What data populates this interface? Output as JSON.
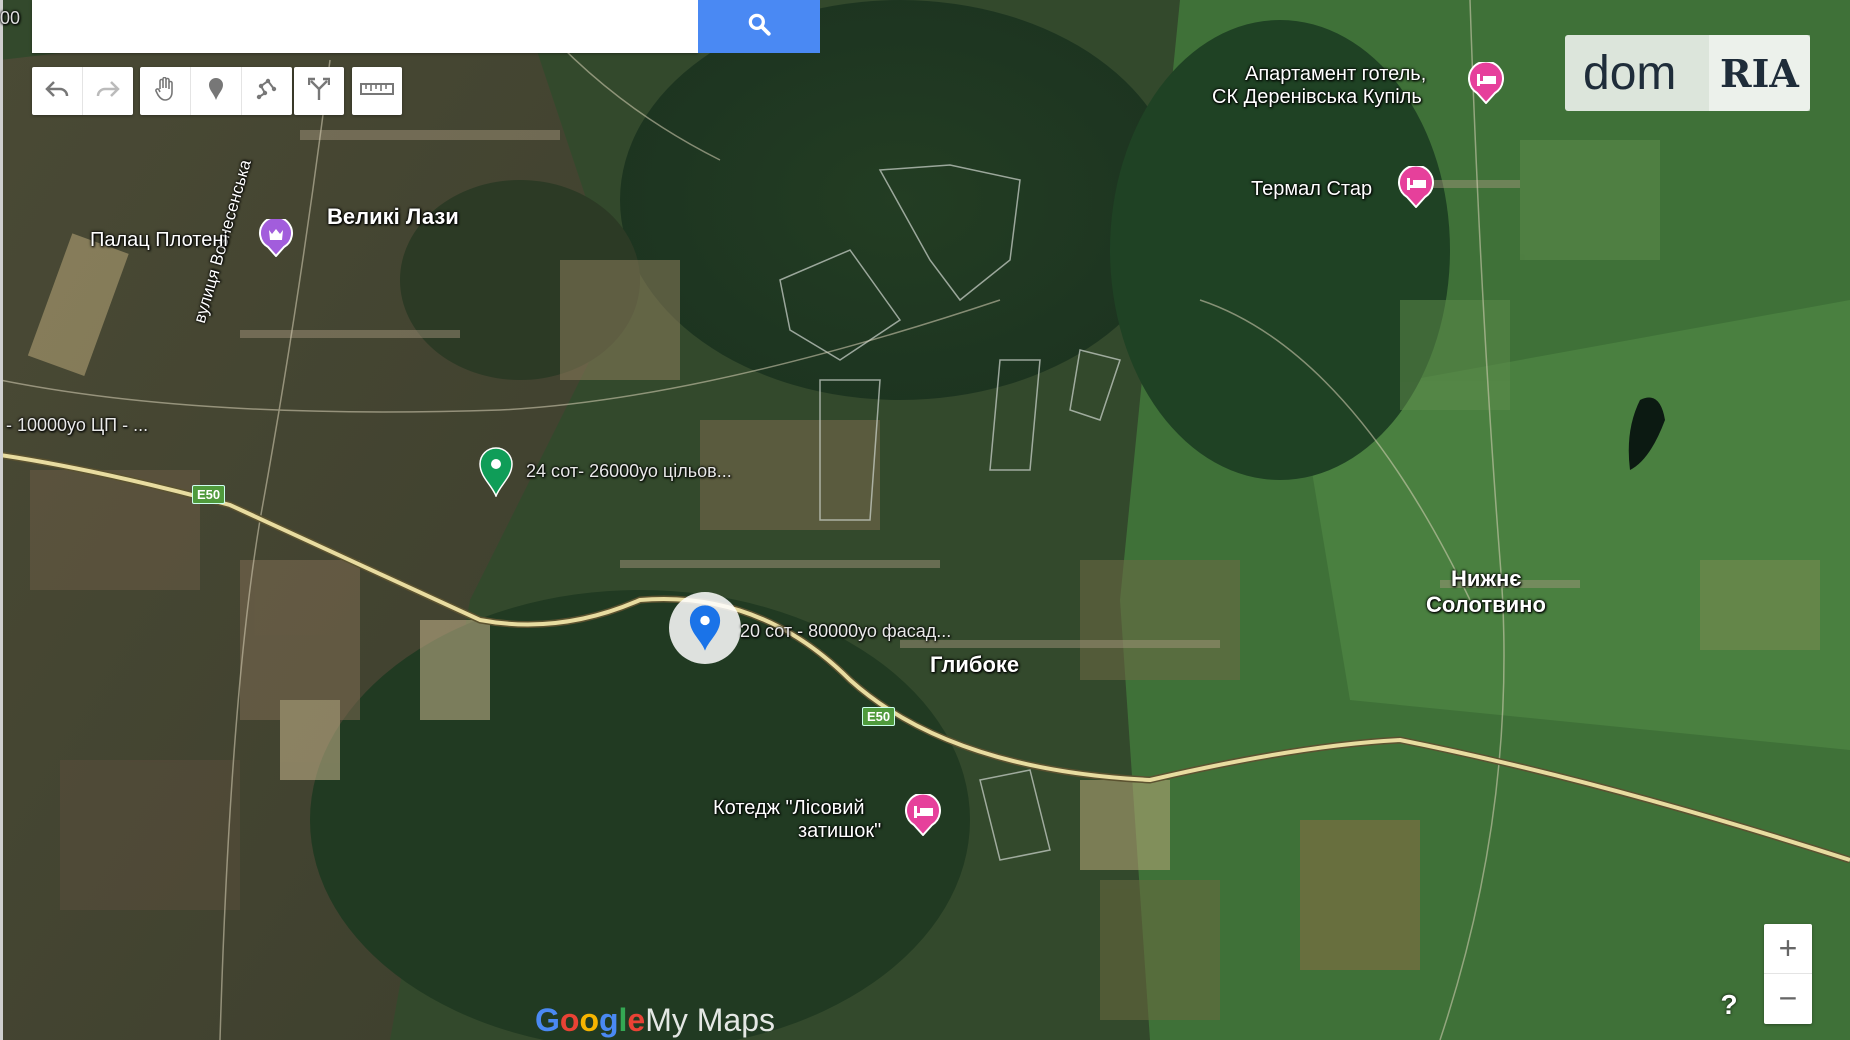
{
  "search": {
    "placeholder": "",
    "value": ""
  },
  "icons": {
    "search": "search-icon",
    "undo": "undo-icon",
    "redo": "redo-icon",
    "hand": "hand-icon",
    "marker": "marker-icon",
    "line": "draw-line-icon",
    "directions": "directions-icon",
    "ruler": "ruler-icon"
  },
  "map": {
    "places": {
      "velyki_lazy": "Великі Лази",
      "hlyboke": "Глибоке",
      "nyzhne_line1": "Нижнє",
      "nyzhne_line2": "Солотвино"
    },
    "street": "вулиця Вознесенська",
    "roads": [
      "E50",
      "E50"
    ],
    "pois": {
      "palace": "Палац Плотені",
      "apartment_line1": "Апартамент готель,",
      "apartment_line2": "СК Деренівська Купіль",
      "thermal": "Термал Стар",
      "cottage_line1": "Котедж \"Лісовий",
      "cottage_line2": "затишок\""
    },
    "markers": {
      "green_label": "24 сот- 26000уо цільов...",
      "blue_label": "20 сот - 80000уо фасад...",
      "left_label": "- 10000уо ЦП - ..."
    },
    "edge_text": "00"
  },
  "logo": {
    "dom": "dom",
    "ria": "RIA"
  },
  "zoom": {
    "in": "+",
    "out": "−"
  },
  "help": "?",
  "brand": {
    "g1": "G",
    "g2": "o",
    "g3": "o",
    "g4": "g",
    "g5": "l",
    "g6": "e",
    "mymaps": "My Maps"
  },
  "colors": {
    "search_button": "#4a89f3",
    "poi_pink": "#e6409b",
    "palace_purple": "#a25ddc",
    "marker_green": "#0f9d58",
    "marker_blue": "#1a73e8",
    "road": "#e8dca0"
  }
}
